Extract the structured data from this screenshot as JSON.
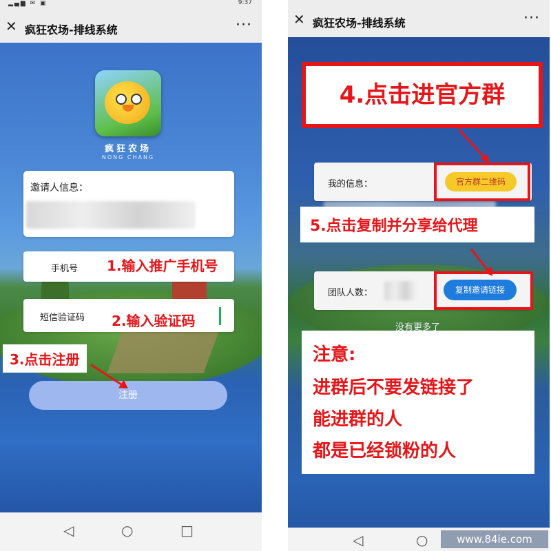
{
  "left": {
    "status_time": "9:37",
    "header": {
      "title": "疯狂农场-排线系统",
      "more": "···"
    },
    "logo": {
      "name_cn": "疯狂农场",
      "name_en": "NONG CHANG"
    },
    "form": {
      "inviter_label": "邀请人信息：",
      "phone_label": "手机号",
      "code_label": "短信验证码",
      "register_label": "注册"
    },
    "annotations": {
      "step1": "1.输入推广手机号",
      "step2": "2.输入验证码",
      "step3": "3.点击注册"
    }
  },
  "right": {
    "header": {
      "title": "疯狂农场-排线系统"
    },
    "my_info_label": "我的信息：",
    "qr_button": "官方群二维码",
    "team_label": "团队人数：",
    "copy_button": "复制邀请链接",
    "no_more": "没有更多了",
    "annotations": {
      "step4": "4.点击进官方群",
      "step5": "5.点击复制并分享给代理",
      "note_title": "注意:",
      "note_line1": "进群后不要发链接了",
      "note_line2": "能进群的人",
      "note_line3": "都是已经锁粉的人"
    }
  },
  "watermark": "www.84ie.com",
  "colors": {
    "annotation_red": "#e5161a",
    "qr_button_bg": "#f5c928",
    "copy_button_bg": "#1f7bdc",
    "register_button_bg": "#9fb7ef"
  }
}
